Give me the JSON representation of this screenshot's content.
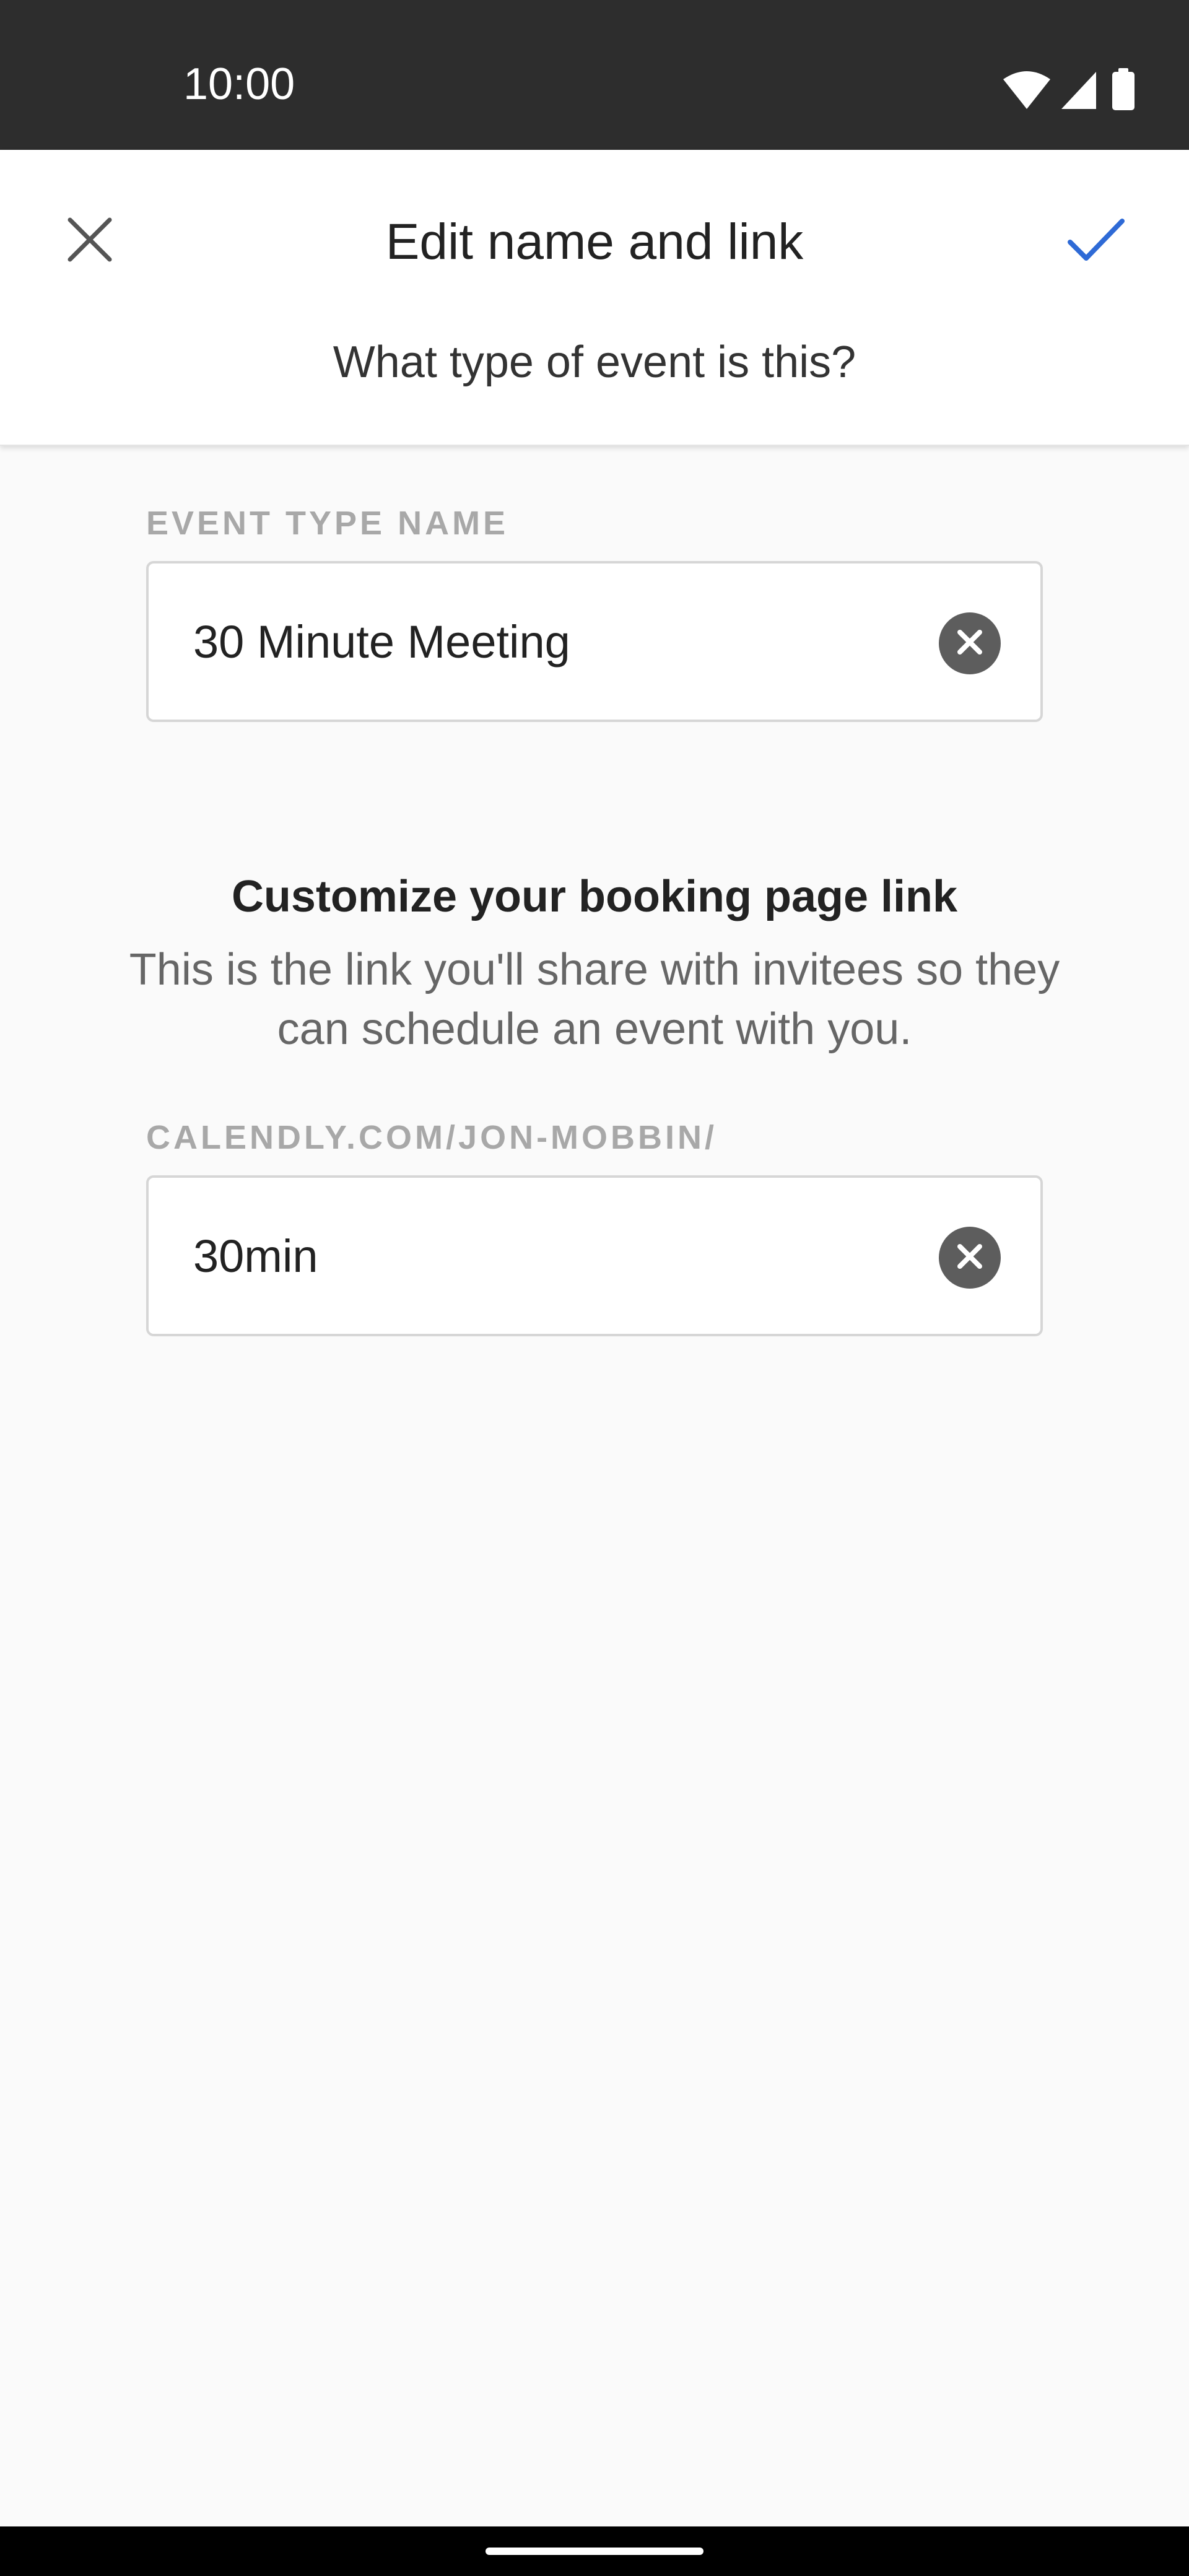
{
  "status_bar": {
    "time": "10:00",
    "icons": [
      "wifi-icon",
      "cellular-signal-icon",
      "battery-icon"
    ]
  },
  "header": {
    "title": "Edit name and link",
    "subtitle": "What type of event is this?",
    "close_icon": "close-icon",
    "confirm_icon": "checkmark-icon",
    "accent_color": "#2e6ad6"
  },
  "event_type_field": {
    "label": "EVENT TYPE NAME",
    "value": "30 Minute Meeting",
    "clear_icon": "clear-circle-icon"
  },
  "booking_link": {
    "heading": "Customize your booking page link",
    "description": "This is the link you'll share with invitees so they can schedule an event with you."
  },
  "slug_field": {
    "label": "CALENDLY.COM/JON-MOBBIN/",
    "value": "30min",
    "clear_icon": "clear-circle-icon"
  }
}
